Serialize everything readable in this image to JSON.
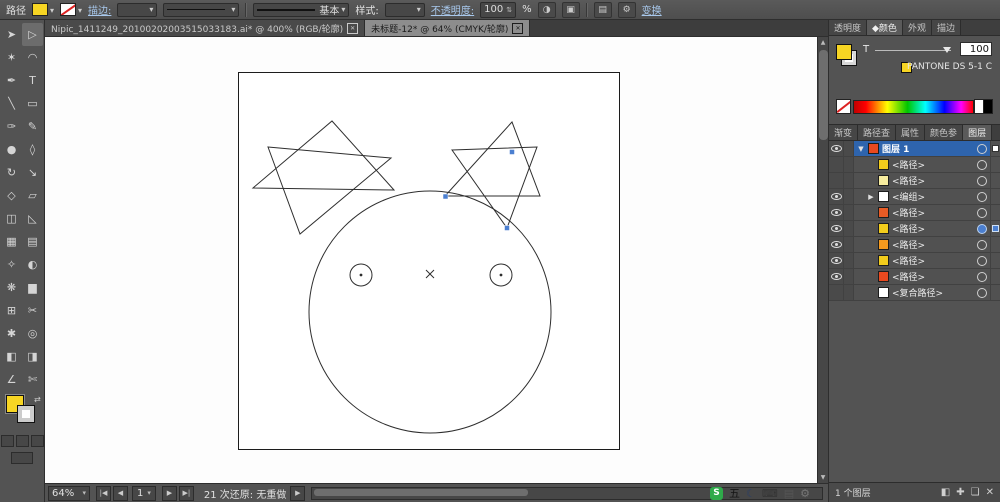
{
  "control_bar": {
    "selection_label": "路径",
    "stroke_label": "描边:",
    "brush_style": "基本",
    "style_label": "样式:",
    "opacity_label": "不透明度:",
    "opacity_value": "100",
    "percent_label": "%",
    "transform_label": "变换"
  },
  "document_tabs": [
    {
      "label": "Nipic_1411249_20100202003515033183.ai* @ 400% (RGB/轮廓)",
      "active": false
    },
    {
      "label": "未标题-12* @ 64% (CMYK/轮廓)",
      "active": true
    }
  ],
  "tools": [
    {
      "name": "selection-tool",
      "glyph": "➤",
      "active": false
    },
    {
      "name": "direct-selection-tool",
      "glyph": "▷",
      "active": true
    },
    {
      "name": "magic-wand-tool",
      "glyph": "✶",
      "active": false
    },
    {
      "name": "lasso-tool",
      "glyph": "◠",
      "active": false
    },
    {
      "name": "pen-tool",
      "glyph": "✒",
      "active": false
    },
    {
      "name": "type-tool",
      "glyph": "T",
      "active": false
    },
    {
      "name": "line-segment-tool",
      "glyph": "╲",
      "active": false
    },
    {
      "name": "rectangle-tool",
      "glyph": "▭",
      "active": false
    },
    {
      "name": "paintbrush-tool",
      "glyph": "✑",
      "active": false
    },
    {
      "name": "pencil-tool",
      "glyph": "✎",
      "active": false
    },
    {
      "name": "blob-brush-tool",
      "glyph": "●",
      "active": false
    },
    {
      "name": "eraser-tool",
      "glyph": "◊",
      "active": false
    },
    {
      "name": "rotate-tool",
      "glyph": "↻",
      "active": false
    },
    {
      "name": "scale-tool",
      "glyph": "↘",
      "active": false
    },
    {
      "name": "width-tool",
      "glyph": "◇",
      "active": false
    },
    {
      "name": "free-transform-tool",
      "glyph": "▱",
      "active": false
    },
    {
      "name": "shape-builder-tool",
      "glyph": "◫",
      "active": false
    },
    {
      "name": "perspective-grid-tool",
      "glyph": "◺",
      "active": false
    },
    {
      "name": "mesh-tool",
      "glyph": "▦",
      "active": false
    },
    {
      "name": "gradient-tool",
      "glyph": "▤",
      "active": false
    },
    {
      "name": "eyedropper-tool",
      "glyph": "✧",
      "active": false
    },
    {
      "name": "blend-tool",
      "glyph": "◐",
      "active": false
    },
    {
      "name": "symbol-sprayer-tool",
      "glyph": "❋",
      "active": false
    },
    {
      "name": "column-graph-tool",
      "glyph": "▆",
      "active": false
    },
    {
      "name": "artboard-tool",
      "glyph": "⊞",
      "active": false
    },
    {
      "name": "slice-tool",
      "glyph": "✂",
      "active": false
    },
    {
      "name": "hand-tool",
      "glyph": "✱",
      "active": false
    },
    {
      "name": "zoom-tool",
      "glyph": "◎",
      "active": false
    },
    {
      "name": "live-paint-bucket-tool",
      "glyph": "◧",
      "active": false
    },
    {
      "name": "live-paint-selection-tool",
      "glyph": "◨",
      "active": false
    },
    {
      "name": "measure-tool",
      "glyph": "∠",
      "active": false
    },
    {
      "name": "knife-tool",
      "glyph": "✄",
      "active": false
    }
  ],
  "right_panel": {
    "top_tabs": [
      {
        "label": "透明度",
        "active": false
      },
      {
        "label": "◆颜色",
        "active": true
      },
      {
        "label": "外观",
        "active": false
      },
      {
        "label": "描边",
        "active": false
      }
    ],
    "color_panel": {
      "type_label": "T",
      "tint_value": "100",
      "swatch_name": "PANTONE DS 5-1 C"
    },
    "mid_tabs": [
      {
        "label": "渐变",
        "active": false
      },
      {
        "label": "路径查",
        "active": false
      },
      {
        "label": "属性",
        "active": false
      },
      {
        "label": "颜色参",
        "active": false
      },
      {
        "label": "图层",
        "active": true
      }
    ],
    "layers": [
      {
        "name": "图层 1",
        "selected": true,
        "expand": "▼",
        "swatch": "#e8491f",
        "eye": true,
        "indent": 0,
        "indicator": "white"
      },
      {
        "name": "<路径>",
        "selected": false,
        "expand": "",
        "swatch": "#f2cc1c",
        "eye": false,
        "indent": 1,
        "indicator": ""
      },
      {
        "name": "<路径>",
        "selected": false,
        "expand": "",
        "swatch": "#f7ec9e",
        "eye": false,
        "indent": 1,
        "indicator": ""
      },
      {
        "name": "<编组>",
        "selected": false,
        "expand": "▶",
        "swatch": "#ffffff",
        "eye": true,
        "indent": 1,
        "indicator": ""
      },
      {
        "name": "<路径>",
        "selected": false,
        "expand": "",
        "swatch": "#e85b25",
        "eye": true,
        "indent": 1,
        "indicator": ""
      },
      {
        "name": "<路径>",
        "selected": false,
        "expand": "",
        "swatch": "#f2cc1c",
        "eye": true,
        "indent": 1,
        "indicator": "blue"
      },
      {
        "name": "<路径>",
        "selected": false,
        "expand": "",
        "swatch": "#f59a1e",
        "eye": true,
        "indent": 1,
        "indicator": ""
      },
      {
        "name": "<路径>",
        "selected": false,
        "expand": "",
        "swatch": "#f2cc1c",
        "eye": true,
        "indent": 1,
        "indicator": ""
      },
      {
        "name": "<路径>",
        "selected": false,
        "expand": "",
        "swatch": "#e8491f",
        "eye": true,
        "indent": 1,
        "indicator": ""
      },
      {
        "name": "<复合路径>",
        "selected": false,
        "expand": "",
        "swatch": "#ffffff",
        "eye": false,
        "indent": 1,
        "indicator": ""
      }
    ],
    "layers_footer": {
      "count_label": "1 个图层",
      "icons": [
        {
          "name": "make-clipping-mask-icon",
          "glyph": "◧"
        },
        {
          "name": "new-sublayer-icon",
          "glyph": "✚"
        },
        {
          "name": "new-layer-icon",
          "glyph": "❏"
        },
        {
          "name": "delete-layer-icon",
          "glyph": "✕"
        }
      ]
    }
  },
  "status_bar": {
    "zoom": "64%",
    "nav": [
      {
        "name": "first-page-button",
        "glyph": "|◀"
      },
      {
        "name": "prev-page-button",
        "glyph": "◀"
      }
    ],
    "page_value": "1",
    "nav2": [
      {
        "name": "next-page-button",
        "glyph": "▶"
      },
      {
        "name": "last-page-button",
        "glyph": "▶|"
      }
    ],
    "history_text": "21 次还原: 无重做",
    "status_expand_glyph": "▶"
  },
  "ime": {
    "icons": [
      {
        "name": "sogou-logo-icon",
        "glyph": "S",
        "style": "sogou"
      },
      {
        "name": "ime-mode-label",
        "glyph": "五",
        "color": "#141414"
      },
      {
        "name": "moon-icon",
        "glyph": "☾",
        "color": "#2b3f66"
      },
      {
        "name": "keyboard-icon",
        "glyph": "⌨",
        "color": "#333333"
      },
      {
        "name": "clipboard-icon",
        "glyph": "▤",
        "color": "#555555"
      },
      {
        "name": "settings-wrench-icon",
        "glyph": "⚙",
        "color": "#777777"
      }
    ]
  }
}
